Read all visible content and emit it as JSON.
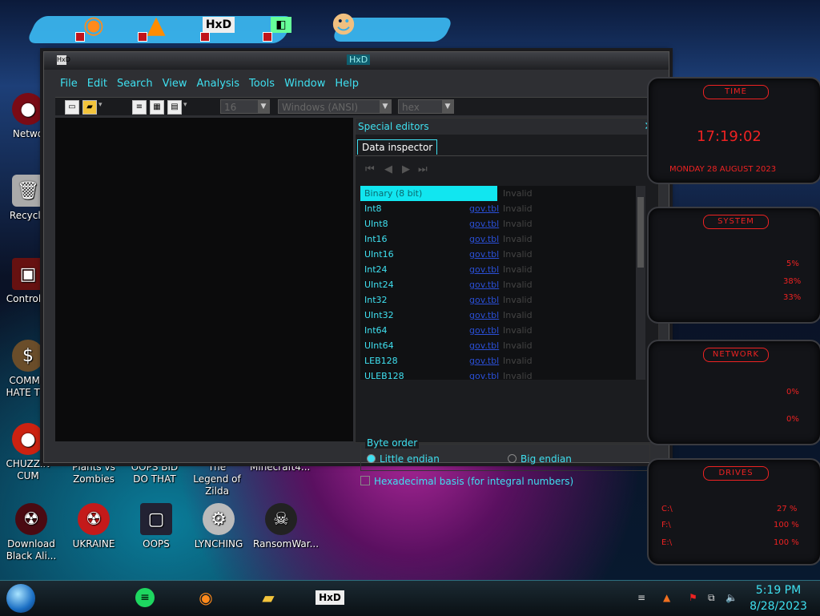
{
  "desktop": {
    "left_icons": [
      {
        "label": "Netwo",
        "icon": "network-icon"
      },
      {
        "label": "Recycle",
        "icon": "recycle-bin-icon"
      },
      {
        "label": "Control P",
        "icon": "control-panel-icon"
      },
      {
        "label": "COMMU HATE THI",
        "icon": "money-bag-icon"
      },
      {
        "label": "CHUZZIN CUM",
        "icon": "chuzzle-icon"
      }
    ],
    "bottom_icons": [
      {
        "label": "Plants vs Zombies"
      },
      {
        "label": "OOPS BID DO THAT"
      },
      {
        "label": "The Legend of Zilda"
      },
      {
        "label": "Minecraft4..."
      }
    ],
    "lower_icons": [
      {
        "label": "Download Black Ali...",
        "icon": "alien-icon"
      },
      {
        "label": "UKRAINE",
        "icon": "radiation-icon"
      },
      {
        "label": "OOPS",
        "icon": "oops-icon"
      },
      {
        "label": "LYNCHING",
        "icon": "lynching-icon"
      },
      {
        "label": "RansomWar...",
        "icon": "skull-icon"
      }
    ]
  },
  "window": {
    "title": "HxD",
    "menu": [
      "File",
      "Edit",
      "Search",
      "View",
      "Analysis",
      "Tools",
      "Window",
      "Help"
    ],
    "toolbar": {
      "bytes_per_row": "16",
      "charset": "Windows (ANSI)",
      "offset_base": "hex"
    }
  },
  "special_editors": {
    "title": "Special editors",
    "tab": "Data inspector",
    "rows": [
      {
        "name": "Binary (8 bit)",
        "link": "",
        "value": "Invalid",
        "selected": true
      },
      {
        "name": "Int8",
        "link": "gov.tbl",
        "value": "Invalid"
      },
      {
        "name": "UInt8",
        "link": "gov.tbl",
        "value": "Invalid"
      },
      {
        "name": "Int16",
        "link": "gov.tbl",
        "value": "Invalid"
      },
      {
        "name": "UInt16",
        "link": "gov.tbl",
        "value": "Invalid"
      },
      {
        "name": "Int24",
        "link": "gov.tbl",
        "value": "Invalid"
      },
      {
        "name": "UInt24",
        "link": "gov.tbl",
        "value": "Invalid"
      },
      {
        "name": "Int32",
        "link": "gov.tbl",
        "value": "Invalid"
      },
      {
        "name": "UInt32",
        "link": "gov.tbl",
        "value": "Invalid"
      },
      {
        "name": "Int64",
        "link": "gov.tbl",
        "value": "Invalid"
      },
      {
        "name": "UInt64",
        "link": "gov.tbl",
        "value": "Invalid"
      },
      {
        "name": "LEB128",
        "link": "gov.tbl",
        "value": "Invalid"
      },
      {
        "name": "ULEB128",
        "link": "gov.tbl",
        "value": "Invalid"
      }
    ],
    "byte_order_label": "Byte order",
    "little_endian": "Little endian",
    "big_endian": "Big endian",
    "hex_basis": "Hexadecimal basis (for integral numbers)"
  },
  "gadgets": {
    "time": {
      "title": "TIME",
      "clock": "17:19:02",
      "date": "MONDAY 28 AUGUST 2023"
    },
    "system": {
      "title": "SYSTEM",
      "cpu": "5%",
      "ram": "38%",
      "swap": "33%"
    },
    "network": {
      "title": "NETWORK",
      "up": "0%",
      "down": "0%"
    },
    "drives": {
      "title": "DRIVES",
      "c": "C:\\",
      "c_val": "27 %",
      "f": "F:\\",
      "f_val": "100 %",
      "e": "E:\\",
      "e_val": "100 %"
    }
  },
  "taskbar": {
    "time": "5:19 PM",
    "date": "8/28/2023"
  },
  "colors": {
    "accent": "#3fe0f0",
    "red": "#e22222"
  }
}
